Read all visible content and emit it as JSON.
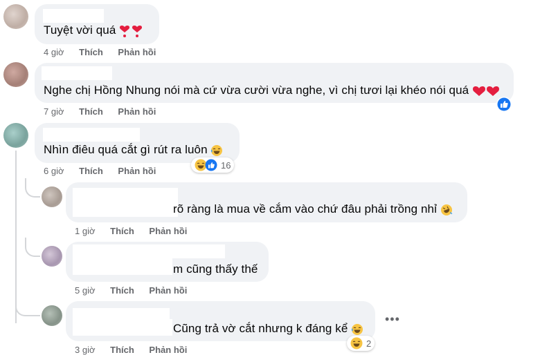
{
  "comments": [
    {
      "text": "Tuyệt vời quá",
      "time": "4 giờ",
      "like_label": "Thích",
      "reply_label": "Phản hồi",
      "avatar_color": "#cdbdb5"
    },
    {
      "text": "Nghe chị Hồng Nhung nói mà cứ vừa cười vừa nghe, vì chị tươi lại khéo nói quá",
      "time": "7 giờ",
      "like_label": "Thích",
      "reply_label": "Phản hồi",
      "avatar_color": "#b89a92"
    },
    {
      "text": "Nhìn điêu quá cắt gì rút ra luôn",
      "time": "6 giờ",
      "like_label": "Thích",
      "reply_label": "Phản hồi",
      "reaction_count": "16",
      "avatar_color": "#8fb3b0"
    }
  ],
  "replies": [
    {
      "text": "rõ ràng là mua về cắm vào chứ đâu phải trồng nhỉ",
      "time": "1 giờ",
      "like_label": "Thích",
      "reply_label": "Phản hồi",
      "avatar_color": "#b0a59e"
    },
    {
      "text": "m cũng thấy thế",
      "time": "5 giờ",
      "like_label": "Thích",
      "reply_label": "Phản hồi",
      "avatar_color": "#b7a8b8"
    },
    {
      "text": "Cũng trả vờ cắt nhưng k đáng kể",
      "time": "3 giờ",
      "like_label": "Thích",
      "reply_label": "Phản hồi",
      "reaction_count": "2",
      "avatar_color": "#8d9a90"
    }
  ],
  "colors": {
    "bubble": "#f0f2f5",
    "meta": "#65676b",
    "like_blue": "#1877f2",
    "heart_red": "#e41e3f",
    "emoji_yellow": "#f7c443"
  },
  "icons": {
    "more": "more-dots-icon",
    "like_reaction": "like-reaction-icon",
    "heart_reaction": "heart-reaction-icon",
    "laugh_reaction": "laugh-reaction-icon"
  }
}
